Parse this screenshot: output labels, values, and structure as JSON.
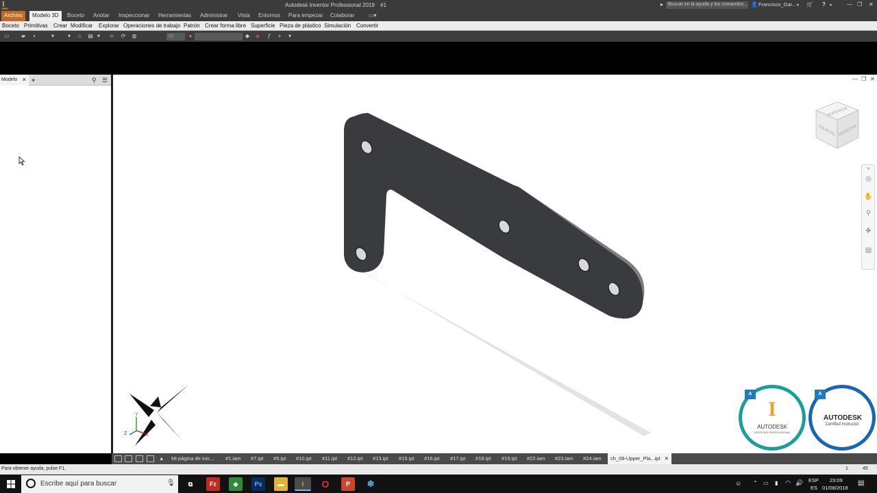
{
  "window": {
    "title": "Autodesk Inventor Professional 2019",
    "doc_marker": "#1",
    "help_search_placeholder": "Buscar en la ayuda y los comandos...",
    "user": "Francisco_Gar...",
    "app_logo": "I",
    "app_logo_sub": "PRO"
  },
  "ribbon": {
    "file_tab": "Archivo",
    "tabs": [
      "Modelo 3D",
      "Boceto",
      "Anotar",
      "Inspeccionar",
      "Herramientas",
      "Administrar",
      "Vista",
      "Entornos",
      "Para empezar",
      "Colaborar"
    ],
    "panels": [
      "Boceto",
      "Primitivas",
      "Crear",
      "Modificar",
      "Explorar",
      "Operaciones de trabajo",
      "Patrón",
      "Crear forma libre",
      "Superficie",
      "Pieza de plástico",
      "Simulación",
      "Convertir"
    ]
  },
  "qat": {
    "appearance_value": "Ni"
  },
  "browser": {
    "tab_label": "Modelo",
    "close_glyph": "✕",
    "add_glyph": "+"
  },
  "viewcube": {
    "top": "SUPERIOR",
    "front": "FRONTAL",
    "right": "DERECHA"
  },
  "axes": {
    "x": "X",
    "y": "Y",
    "z": "Z"
  },
  "doc_tabs": {
    "items": [
      "Mi página de inic...",
      "#1.iam",
      "#7.ipt",
      "#9.ipt",
      "#10.ipt",
      "#11.ipt",
      "#12.ipt",
      "#13.ipt",
      "#15.ipt",
      "#16.ipt",
      "#17.ipt",
      "#18.ipt",
      "#19.ipt",
      "#22.iam",
      "#23.iam",
      "#24.iam"
    ],
    "active": "ch_09-Upper_Pla...ipt",
    "close_glyph": "✕"
  },
  "status": {
    "help_text": "Para obtener ayuda, pulse F1.",
    "value1": "1",
    "value2": "45"
  },
  "taskbar": {
    "search_placeholder": "Escribe aquí para buscar",
    "lang_top": "ESP",
    "lang_bottom": "ES",
    "time": "23:09",
    "date": "01/08/2018"
  },
  "badges": [
    {
      "brand": "AUTODESK",
      "sub": "CERTIFIED PROFESSIONAL",
      "ring": "#1a9e9a"
    },
    {
      "brand": "AUTODESK",
      "sub": "Certified Instructor",
      "ring": "#1966b8"
    }
  ],
  "colors": {
    "file_tab": "#c66a1f",
    "part_body": "#3a3b3e",
    "ribbon_dark": "#3b3b3b"
  }
}
